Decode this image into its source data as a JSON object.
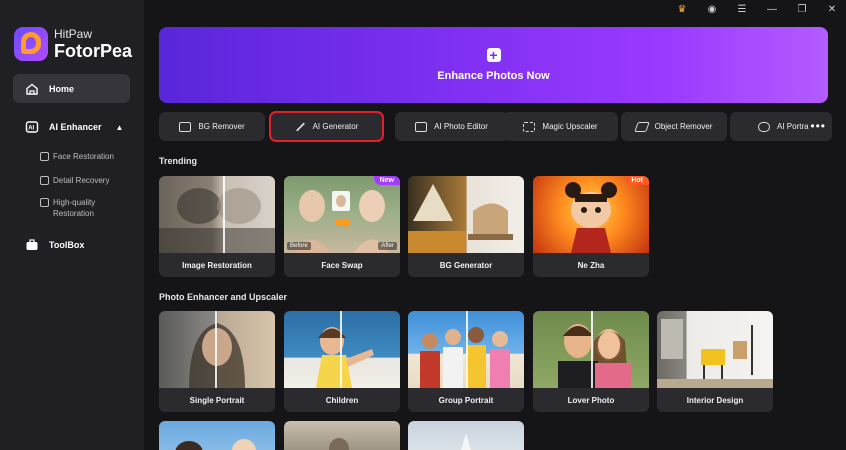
{
  "app": {
    "brand_line1": "HitPaw",
    "brand_line2": "FotorPea"
  },
  "sidebar": {
    "home_label": "Home",
    "ai_enhancer_label": "AI Enhancer",
    "sub_items": [
      {
        "label": "Face Restoration"
      },
      {
        "label": "Detail Recovery"
      },
      {
        "label": "High-quality Restoration"
      }
    ],
    "toolbox_label": "ToolBox"
  },
  "window": {
    "icons": [
      "crown-icon",
      "user-icon",
      "menu-icon",
      "minimize-icon",
      "maximize-icon",
      "close-icon"
    ]
  },
  "hero": {
    "label": "Enhance Photos Now"
  },
  "tools": [
    {
      "label": "BG Remover",
      "icon": "bg-remover-icon"
    },
    {
      "label": "AI Generator",
      "icon": "magic-wand-icon",
      "active": true
    },
    {
      "label": "AI Photo Editor",
      "icon": "photo-editor-icon"
    },
    {
      "label": "Magic Upscaler",
      "icon": "upscale-icon"
    },
    {
      "label": "Object Remover",
      "icon": "eraser-icon"
    },
    {
      "label": "AI Portra",
      "icon": "portrait-icon"
    }
  ],
  "trending": {
    "title": "Trending",
    "cards": [
      {
        "label": "Image Restoration"
      },
      {
        "label": "Face Swap",
        "badge": "New",
        "before": "Before",
        "after": "After"
      },
      {
        "label": "BG Generator"
      },
      {
        "label": "Ne Zha",
        "badge": "Hot"
      }
    ]
  },
  "enhancer": {
    "title": "Photo Enhancer and Upscaler",
    "cards": [
      {
        "label": "Single Portrait"
      },
      {
        "label": "Children"
      },
      {
        "label": "Group Portrait"
      },
      {
        "label": "Lover Photo"
      },
      {
        "label": "Interior Design"
      }
    ]
  },
  "colors": {
    "accent": "#8a3cf5",
    "highlight_border": "#e0202b",
    "badge_new": "#a33cff",
    "badge_hot": "#ff5a1f"
  }
}
